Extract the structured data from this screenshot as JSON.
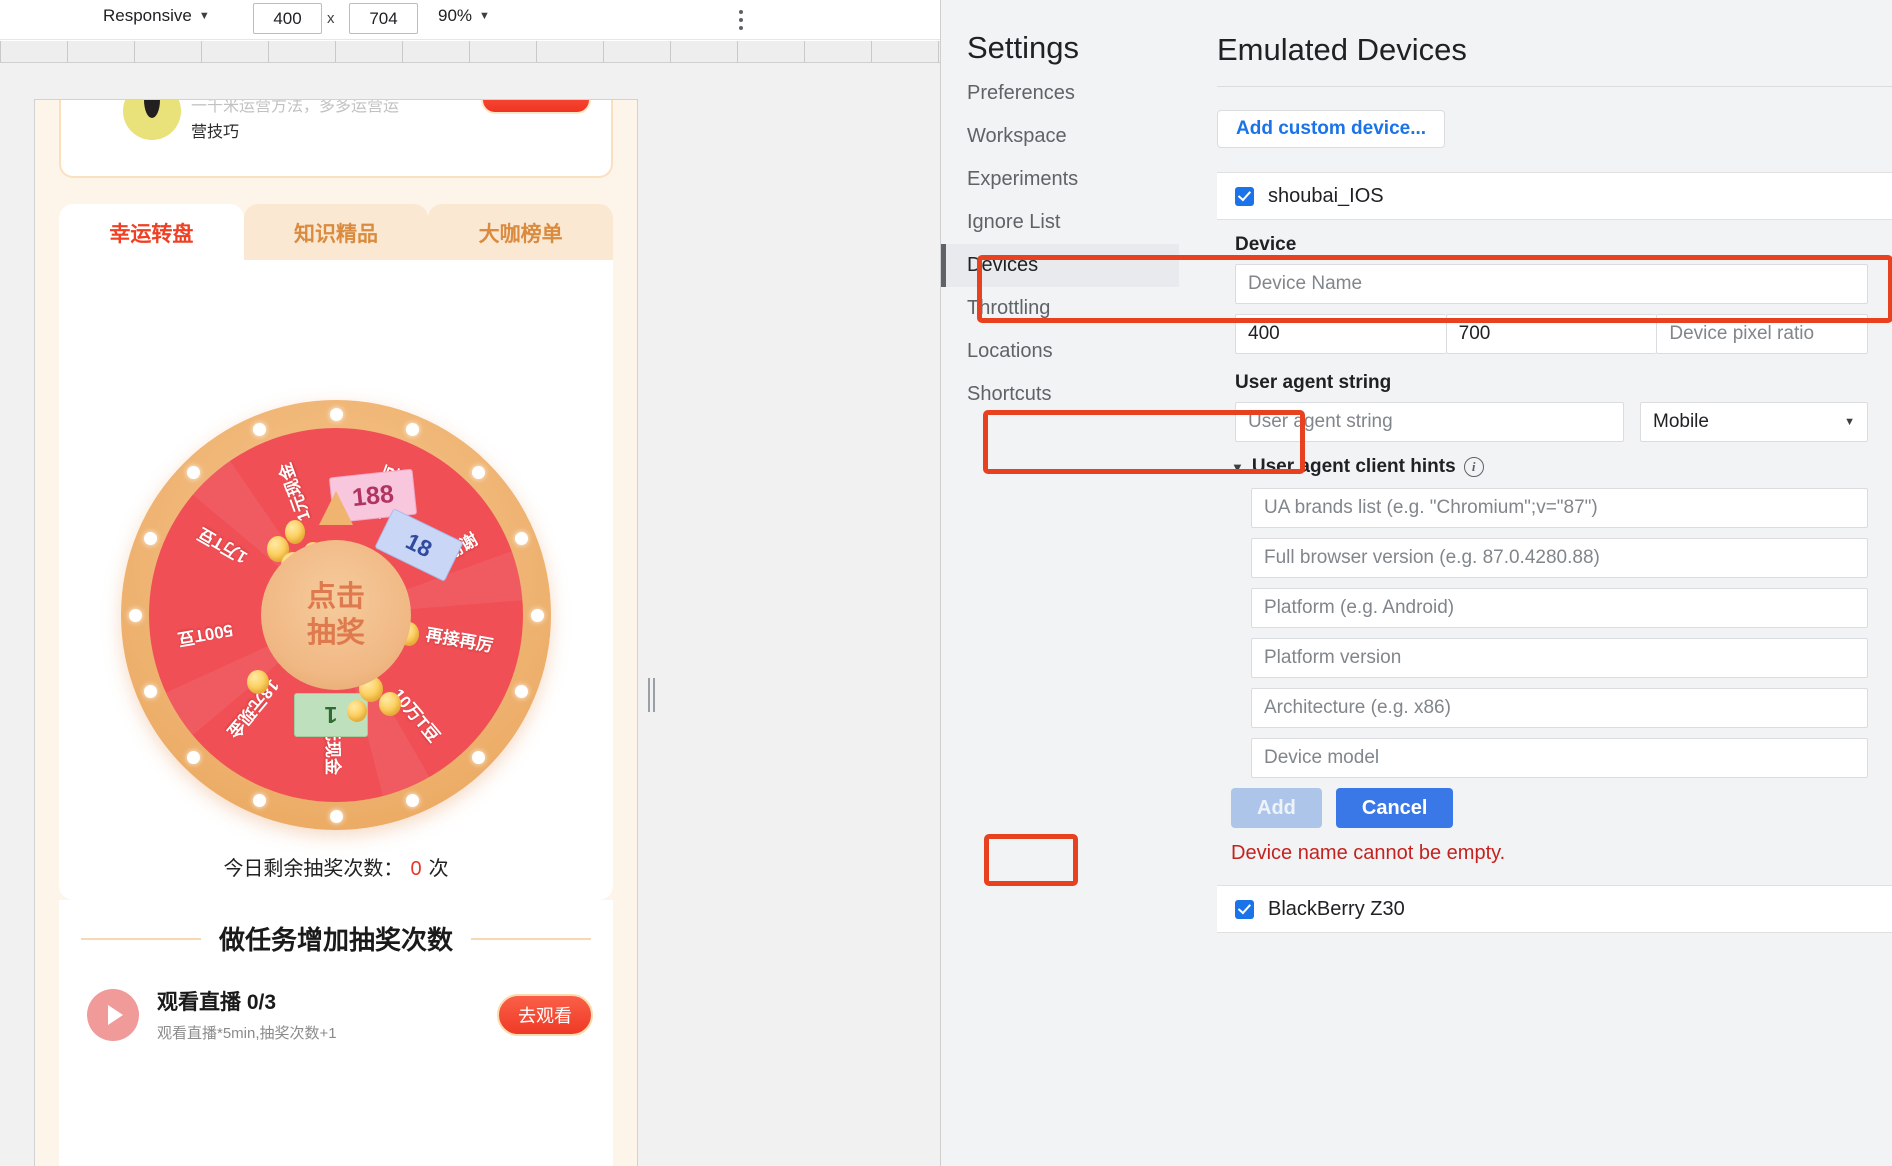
{
  "device_toolbar": {
    "device_preset": "Responsive",
    "width": "400",
    "height": "704",
    "x_separator": "x",
    "zoom": "90%",
    "caret": "▼",
    "more_options_title": "More options"
  },
  "emulated_page": {
    "promo": {
      "line1": "一千米运营方法，多多运营运",
      "line2": "营技巧",
      "button_label": ""
    },
    "tabs": [
      {
        "label": "幸运转盘",
        "active": true
      },
      {
        "label": "知识精品",
        "active": false
      },
      {
        "label": "大咖榜单",
        "active": false
      }
    ],
    "wheel": {
      "center_line1": "点击",
      "center_line2": "抽奖",
      "segments": [
        {
          "label": "188元现金"
        },
        {
          "label": "18元现金"
        },
        {
          "label": "500T豆"
        },
        {
          "label": "1万T豆"
        },
        {
          "label": "1元现金"
        },
        {
          "label": "100T豆"
        },
        {
          "label": "谢谢"
        },
        {
          "label": "再接再厉"
        },
        {
          "label": "10万T豆"
        }
      ],
      "note_188": "188",
      "note_18": "18",
      "note_1": "1"
    },
    "remaining": {
      "label": "今日剩余抽奖次数：",
      "count": "0",
      "unit": "次"
    },
    "task_section": {
      "title": "做任务增加抽奖次数",
      "tasks": [
        {
          "name": "观看直播 0/3",
          "desc": "观看直播*5min,抽奖次数+1",
          "button": "去观看"
        }
      ]
    }
  },
  "settings": {
    "heading": "Settings",
    "nav": [
      {
        "label": "Preferences",
        "selected": false
      },
      {
        "label": "Workspace",
        "selected": false
      },
      {
        "label": "Experiments",
        "selected": false
      },
      {
        "label": "Ignore List",
        "selected": false
      },
      {
        "label": "Devices",
        "selected": true
      },
      {
        "label": "Throttling",
        "selected": false
      },
      {
        "label": "Locations",
        "selected": false
      },
      {
        "label": "Shortcuts",
        "selected": false
      }
    ],
    "main": {
      "title": "Emulated Devices",
      "add_custom_device": "Add custom device...",
      "devices": [
        {
          "name": "shoubai_IOS",
          "checked": true
        },
        {
          "name": "BlackBerry Z30",
          "checked": true
        }
      ],
      "editor": {
        "device_label": "Device",
        "device_name_placeholder": "Device Name",
        "width_value": "400",
        "height_value": "700",
        "dpr_placeholder": "Device pixel ratio",
        "ua_label": "User agent string",
        "ua_placeholder": "User agent string",
        "ua_type_selected": "Mobile",
        "select_arrow": "▼",
        "client_hints_label": "User agent client hints",
        "client_hints_toggle": "▼",
        "info_glyph": "i",
        "hints": [
          "UA brands list (e.g. \"Chromium\";v=\"87\")",
          "Full browser version (e.g. 87.0.4280.88)",
          "Platform (e.g. Android)",
          "Platform version",
          "Architecture (e.g. x86)",
          "Device model"
        ],
        "add_button": "Add",
        "cancel_button": "Cancel",
        "error": "Device name cannot be empty."
      }
    }
  },
  "colors": {
    "accent_blue": "#1a73e8",
    "annotation_red": "#e8411f",
    "error_red": "#c5221f",
    "wheel_red": "#ef4f55",
    "wheel_gold": "#efb473",
    "tab_active": "#ef4024"
  }
}
